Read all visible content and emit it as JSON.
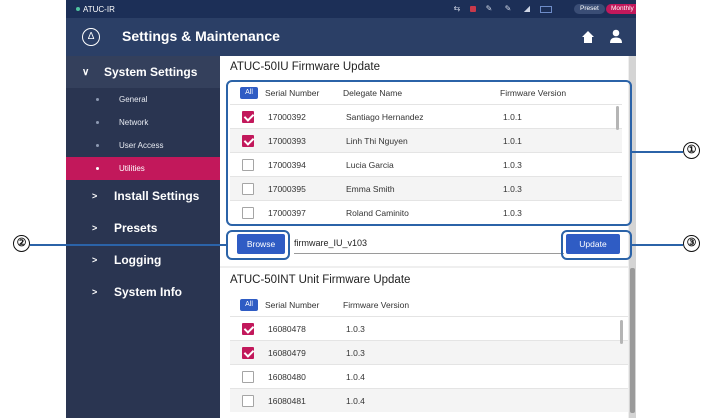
{
  "statusbar": {
    "app_name": "ATUC-IR",
    "preset_label": "Preset",
    "meeting_label": "Monthly Sales Meeting ×"
  },
  "header": {
    "title": "Settings & Maintenance"
  },
  "sidebar": {
    "system_settings": "System Settings",
    "sub_items": [
      "General",
      "Network",
      "User Access",
      "Utilities"
    ],
    "install_settings": "Install Settings",
    "presets": "Presets",
    "logging": "Logging",
    "system_info": "System Info"
  },
  "firmware_update": {
    "title": "ATUC-50IU Firmware Update",
    "all_label": "All",
    "col_serial": "Serial Number",
    "col_delegate": "Delegate Name",
    "col_version": "Firmware Version",
    "rows": [
      {
        "serial": "17000392",
        "name": "Santiago Hernandez",
        "version": "1.0.1",
        "checked": true
      },
      {
        "serial": "17000393",
        "name": "Linh Thi Nguyen",
        "version": "1.0.1",
        "checked": true
      },
      {
        "serial": "17000394",
        "name": "Lucia Garcia",
        "version": "1.0.3",
        "checked": false
      },
      {
        "serial": "17000395",
        "name": "Emma Smith",
        "version": "1.0.3",
        "checked": false
      },
      {
        "serial": "17000397",
        "name": "Roland Caminito",
        "version": "1.0.3",
        "checked": false
      }
    ],
    "browse_label": "Browse",
    "file_name": "firmware_IU_v103",
    "update_label": "Update"
  },
  "unit_update": {
    "title": "ATUC-50INT Unit Firmware Update",
    "all_label": "All",
    "col_serial": "Serial Number",
    "col_version": "Firmware Version",
    "rows": [
      {
        "serial": "16080478",
        "version": "1.0.3",
        "checked": true
      },
      {
        "serial": "16080479",
        "version": "1.0.3",
        "checked": true
      },
      {
        "serial": "16080480",
        "version": "1.0.4",
        "checked": false
      },
      {
        "serial": "16080481",
        "version": "1.0.4",
        "checked": false
      }
    ]
  },
  "callouts": [
    "①",
    "②",
    "③"
  ],
  "colors": {
    "accent": "#c2185b",
    "primary_button": "#2f5cc4",
    "callout_outline": "#2b63a8",
    "sidebar": "#2a3551"
  }
}
